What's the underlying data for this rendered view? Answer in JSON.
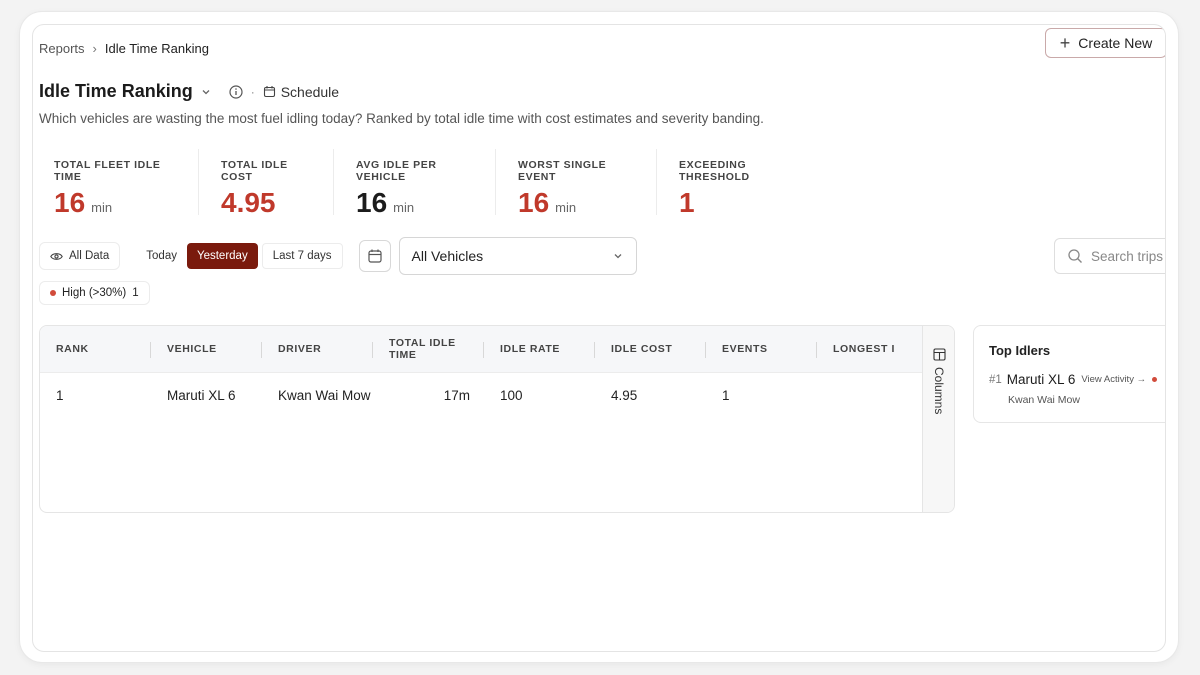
{
  "breadcrumb": {
    "parent": "Reports",
    "current": "Idle Time Ranking"
  },
  "header": {
    "create_label": "Create New",
    "title": "Idle Time Ranking",
    "schedule_label": "Schedule",
    "description": "Which vehicles are wasting the most fuel idling today? Ranked by total idle time with cost estimates and severity banding."
  },
  "kpis": [
    {
      "label": "TOTAL FLEET IDLE TIME",
      "value": "16",
      "unit": "min",
      "color": "#c0392b"
    },
    {
      "label": "TOTAL IDLE COST",
      "value": "4.95",
      "unit": "",
      "color": "#c0392b"
    },
    {
      "label": "AVG IDLE PER VEHICLE",
      "value": "16",
      "unit": "min",
      "color": "#1c1c1c"
    },
    {
      "label": "WORST SINGLE EVENT",
      "value": "16",
      "unit": "min",
      "color": "#c0392b"
    },
    {
      "label": "EXCEEDING THRESHOLD",
      "value": "1",
      "unit": "",
      "color": "#c0392b"
    }
  ],
  "filters": {
    "all_data": "All Data",
    "ranges": [
      "Today",
      "Yesterday",
      "Last 7 days"
    ],
    "active_range": "Yesterday",
    "vehicle_select": "All Vehicles",
    "search_placeholder": "Search trips"
  },
  "severity_chip": {
    "label": "High (>30%)",
    "count": "1",
    "color": "#d14b3b"
  },
  "table": {
    "headers": [
      "RANK",
      "VEHICLE",
      "DRIVER",
      "TOTAL IDLE TIME",
      "IDLE RATE",
      "IDLE COST",
      "EVENTS",
      "LONGEST I"
    ],
    "rows": [
      {
        "rank": "1",
        "vehicle": "Maruti XL 6",
        "driver": "Kwan Wai Mow",
        "total_idle_time": "17m",
        "idle_rate": "100",
        "idle_cost": "4.95",
        "events": "1",
        "longest": ""
      }
    ],
    "columns_label": "Columns"
  },
  "top_idlers": {
    "title": "Top Idlers",
    "items": [
      {
        "rank": "#1",
        "vehicle": "Maruti XL 6",
        "link": "View Activity →",
        "driver": "Kwan Wai Mow"
      }
    ]
  }
}
